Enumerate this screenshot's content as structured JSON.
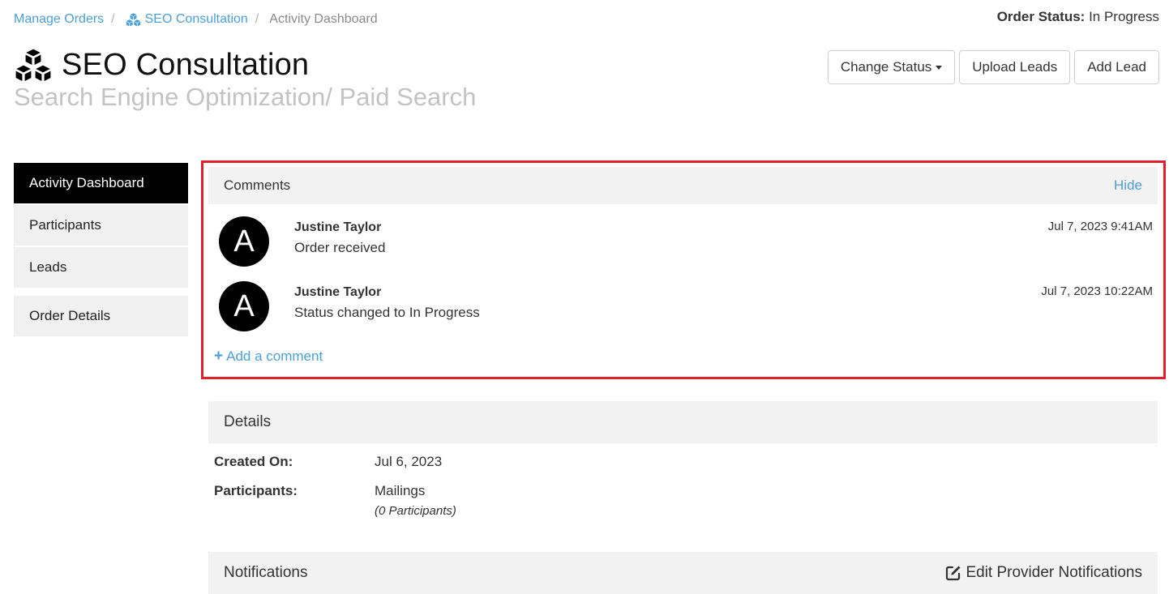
{
  "breadcrumb": {
    "manage_orders": "Manage Orders",
    "order": "SEO Consultation",
    "current": "Activity Dashboard",
    "sep": "/"
  },
  "order_status": {
    "label": "Order Status:",
    "value": "In Progress"
  },
  "page": {
    "title": "SEO Consultation",
    "subtitle": "Search Engine Optimization/ Paid Search"
  },
  "actions": {
    "change_status": "Change Status",
    "upload_leads": "Upload Leads",
    "add_lead": "Add Lead"
  },
  "sidebar": {
    "items": [
      {
        "label": "Activity Dashboard"
      },
      {
        "label": "Participants"
      },
      {
        "label": "Leads"
      },
      {
        "label": "Order Details"
      }
    ]
  },
  "comments": {
    "title": "Comments",
    "hide": "Hide",
    "items": [
      {
        "avatar": "A",
        "author": "Justine Taylor",
        "text": "Order received",
        "time": "Jul 7, 2023 9:41AM"
      },
      {
        "avatar": "A",
        "author": "Justine Taylor",
        "text": "Status changed to In Progress",
        "time": "Jul 7, 2023 10:22AM"
      }
    ],
    "add": "Add a comment"
  },
  "details": {
    "title": "Details",
    "created_label": "Created On:",
    "created_value": "Jul 6, 2023",
    "participants_label": "Participants:",
    "participants_value": "Mailings",
    "participants_count": "(0 Participants)"
  },
  "notifications": {
    "title": "Notifications",
    "edit": "Edit Provider Notifications"
  },
  "colors": {
    "link": "#4a9fd8",
    "highlight": "#e0202b",
    "active_nav": "#000000"
  },
  "icons": {
    "order": "cubes-icon",
    "add": "plus-icon",
    "edit": "edit-icon"
  }
}
